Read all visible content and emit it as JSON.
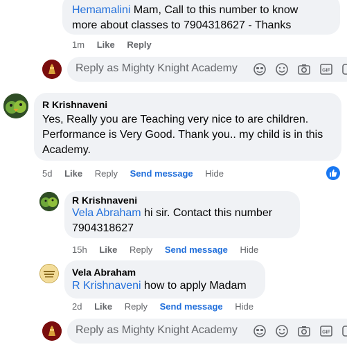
{
  "top_comment": {
    "mention": "Hemamalini",
    "text_line1": " Mam, Call to this number to know",
    "text_line2": "more about classes to 7904318627 - Thanks",
    "time": "1m",
    "like": "Like",
    "reply": "Reply"
  },
  "reply_box_1": {
    "placeholder": "Reply as Mighty Knight Academy"
  },
  "comment_main": {
    "author": "R Krishnaveni",
    "line1": "Yes, Really you are Teaching very nice to are children.",
    "line2": "Performance is Very Good. Thank you.. my child is in this",
    "line3": "Academy.",
    "time": "5d",
    "like": "Like",
    "reply": "Reply",
    "send_message": "Send message",
    "hide": "Hide"
  },
  "reply_1": {
    "author": "R Krishnaveni",
    "mention": "Vela Abraham",
    "text1": " hi sir. Contact this number",
    "text2": "7904318627",
    "time": "15h",
    "like": "Like",
    "reply": "Reply",
    "send_message": "Send message",
    "hide": "Hide"
  },
  "reply_2": {
    "author": "Vela Abraham",
    "mention": "R Krishnaveni",
    "text": " how to apply Madam",
    "time": "2d",
    "like": "Like",
    "reply": "Reply",
    "send_message": "Send message",
    "hide": "Hide"
  },
  "reply_box_2": {
    "placeholder": "Reply as Mighty Knight Academy"
  },
  "colors": {
    "accent": "#216fdb",
    "bubble": "#f0f2f5",
    "muted": "#65676b"
  }
}
